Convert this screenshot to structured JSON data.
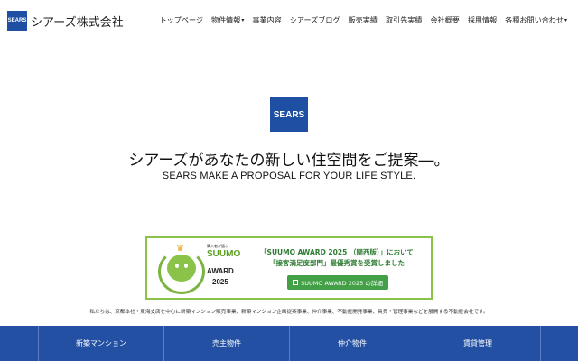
{
  "header": {
    "logo_mark": "SEARS",
    "company_name": "シアーズ株式会社"
  },
  "nav": {
    "items": [
      {
        "label": "トップページ",
        "caret": ""
      },
      {
        "label": "物件情報",
        "caret": "▾"
      },
      {
        "label": "事業内容",
        "caret": ""
      },
      {
        "label": "シアーズブログ",
        "caret": ""
      },
      {
        "label": "販売実績",
        "caret": ""
      },
      {
        "label": "取引先実績",
        "caret": ""
      },
      {
        "label": "会社概要",
        "caret": ""
      },
      {
        "label": "採用情報",
        "caret": ""
      },
      {
        "label": "各種お問い合わせ",
        "caret": "▾"
      }
    ]
  },
  "hero": {
    "mark": "SEARS",
    "tagline_ja": "シアーズがあなたの新しい住空間をご提案―。",
    "tagline_en": "SEARS MAKE A PROPOSAL FOR YOUR LIFE STYLE."
  },
  "award": {
    "badge_small": "購入者が選ぶ",
    "badge_brand": "SUUMO",
    "badge_award": "AWARD",
    "badge_year": "2025",
    "line1": "「SUUMO AWARD 2025 （関西版）」において",
    "line2": "「接客満足度部門」最優秀賞を受賞しました",
    "button_label": "SUUMO AWARD 2025 の詳細"
  },
  "intro_text": "私たちは、京都本社・東海支店を中心に新築マンション販売事業、新築マンション企画提案事業、仲介事業、不動産開発事業、賃貸・管理事業などを展開する不動産会社です。",
  "categories": [
    "新築マンション",
    "売主物件",
    "仲介物件",
    "賃貸管理"
  ],
  "colors": {
    "brand_blue": "#1f4fa3",
    "award_green": "#8bc34a",
    "button_green": "#43a047",
    "nav_bar": "#2350a3"
  }
}
